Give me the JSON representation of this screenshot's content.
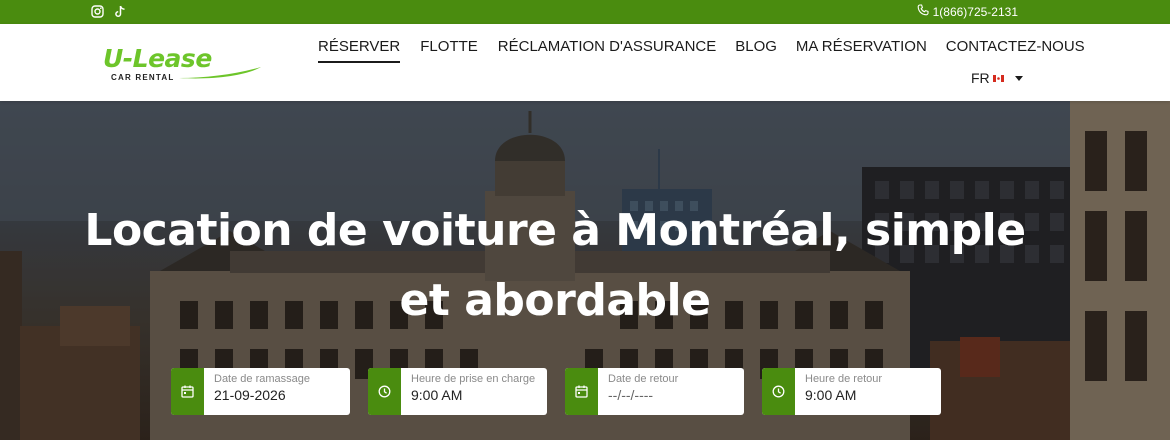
{
  "topbar": {
    "phone": "1(866)725-2131",
    "social_icons": [
      "instagram-icon",
      "tiktok-icon"
    ],
    "background": "#4a8c0f"
  },
  "logo": {
    "primary": "U-Lease",
    "tagline": "CAR RENTAL",
    "accent_color": "#6dc52a"
  },
  "nav": {
    "items": [
      {
        "label": "RÉSERVER",
        "active": true
      },
      {
        "label": "FLOTTE",
        "active": false
      },
      {
        "label": "RÉCLAMATION D'ASSURANCE",
        "active": false
      },
      {
        "label": "BLOG",
        "active": false
      },
      {
        "label": "MA RÉSERVATION",
        "active": false
      },
      {
        "label": "CONTACTEZ-NOUS",
        "active": false
      }
    ],
    "language": "FR"
  },
  "hero": {
    "title_line1": "Location de voiture à Montréal, simple",
    "title_line2": "et abordable"
  },
  "booking": {
    "pickup_date_label": "Date de ramassage",
    "pickup_date_value": "21-09-2026",
    "pickup_time_label": "Heure de prise en charge",
    "pickup_time_value": "9:00 AM",
    "return_date_label": "Date de retour",
    "return_date_placeholder": "--/--/----",
    "return_time_label": "Heure de retour",
    "return_time_value": "9:00 AM"
  }
}
